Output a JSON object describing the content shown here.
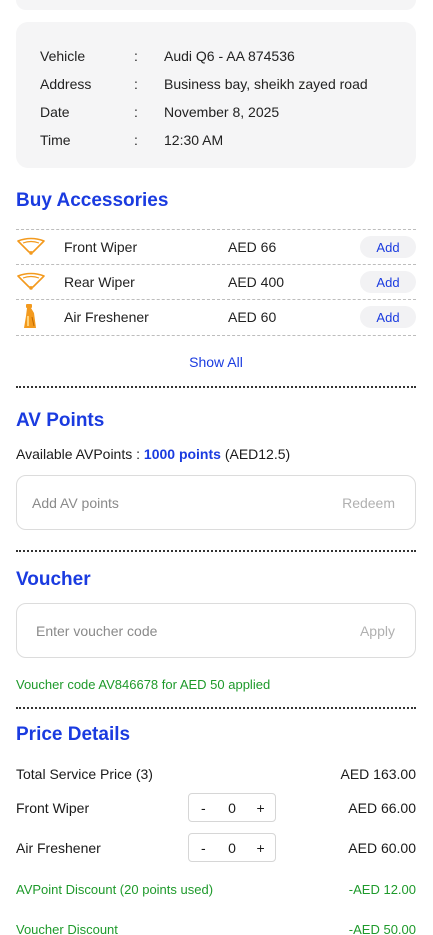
{
  "booking": {
    "rows": [
      {
        "label": "Vehicle",
        "sep": ":",
        "value": "Audi Q6 - AA 874536"
      },
      {
        "label": "Address",
        "sep": ":",
        "value": "Business bay, sheikh zayed road"
      },
      {
        "label": "Date",
        "sep": ":",
        "value": "November 8, 2025"
      },
      {
        "label": "Time",
        "sep": ":",
        "value": "12:30 AM"
      }
    ]
  },
  "accessories": {
    "title": "Buy Accessories",
    "items": [
      {
        "name": "Front Wiper",
        "price": "AED 66",
        "action": "Add",
        "icon": "wiper-icon"
      },
      {
        "name": "Rear Wiper",
        "price": "AED 400",
        "action": "Add",
        "icon": "wiper-icon"
      },
      {
        "name": "Air Freshener",
        "price": "AED 60",
        "action": "Add",
        "icon": "air-freshener-icon"
      }
    ],
    "show_all": "Show All"
  },
  "av_points": {
    "title": "AV Points",
    "available_prefix": "Available AVPoints : ",
    "points": "1000 points",
    "aed": " (AED12.5)",
    "input_placeholder": "Add AV points",
    "action": "Redeem"
  },
  "voucher": {
    "title": "Voucher",
    "input_placeholder": "Enter voucher code",
    "action": "Apply",
    "message": "Voucher code AV846678 for AED 50 applied"
  },
  "price": {
    "title": "Price Details",
    "total_label": "Total Service Price (3)",
    "total_value": "AED 163.00",
    "items": [
      {
        "label": "Front Wiper",
        "minus": "-",
        "qty": "0",
        "plus": "+",
        "value": "AED 66.00"
      },
      {
        "label": "Air Freshener",
        "minus": "-",
        "qty": "0",
        "plus": "+",
        "value": "AED 60.00"
      }
    ],
    "av_discount_label": "AVPoint Discount (20 points used)",
    "av_discount_value": "-AED 12.00",
    "voucher_discount_label": "Voucher Discount",
    "voucher_discount_value": "-AED 50.00"
  },
  "colors": {
    "accent": "#1a3be0",
    "success": "#1e9a2b",
    "card_bg": "#f5f5f6",
    "icon_orange": "#f39a1e"
  }
}
